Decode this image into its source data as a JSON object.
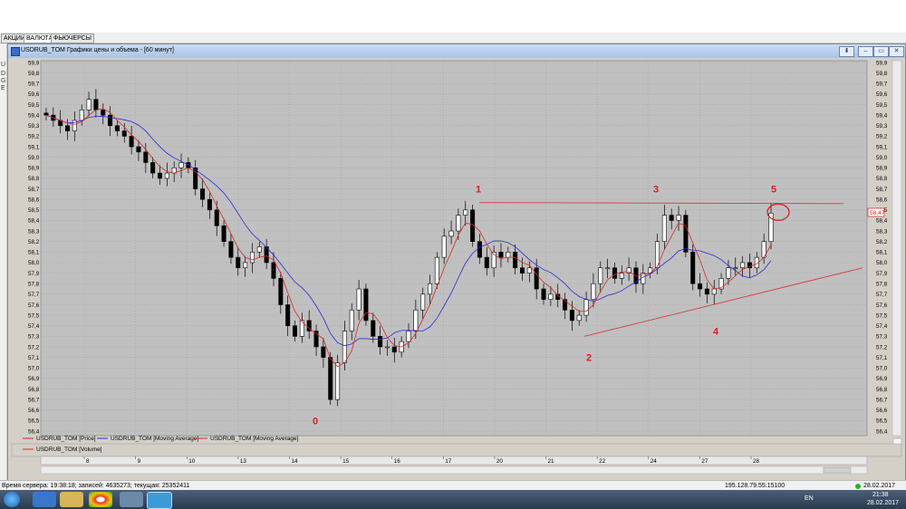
{
  "tabs": [
    "АКЦИИ",
    "ВАЛЮТА",
    "ФЬЮЧЕРСЫ"
  ],
  "left_letters": [
    "U",
    "D",
    "G",
    "E"
  ],
  "window": {
    "title": "USDRUB_TOM Графики цены и объема - [60 минут]"
  },
  "legend": {
    "price": "USDRUB_TOM [Price]",
    "ma1": "USDRUB_TOM [Moving Average]",
    "ma2": "USDRUB_TOM [Moving Average]",
    "volume": "USDRUB_TOM [Volume]"
  },
  "current_price_label": "58,47",
  "status": {
    "server_time": "Время сервера: 19:38:18; записей: 4635273; текущая: 25352411",
    "connection": "195.128.79.55:15100",
    "date": "28.02.2017"
  },
  "taskbar": {
    "lang": "EN",
    "time": "21:38",
    "date": "28.02.2017"
  },
  "colors": {
    "price": "#000000",
    "ma_fast": "#d42a2a",
    "ma_slow": "#2a2ad4",
    "trend": "#d43a3a",
    "annotation": "#d42020"
  },
  "chart_data": {
    "type": "candlestick",
    "ylim": [
      56.4,
      59.9
    ],
    "yticks": [
      59.9,
      59.8,
      59.7,
      59.6,
      59.5,
      59.4,
      59.3,
      59.2,
      59.1,
      59.0,
      58.9,
      58.8,
      58.7,
      58.6,
      58.5,
      58.4,
      58.3,
      58.2,
      58.1,
      58.0,
      57.9,
      57.8,
      57.7,
      57.6,
      57.5,
      57.4,
      57.3,
      57.2,
      57.1,
      57.0,
      56.9,
      56.8,
      56.7,
      56.6,
      56.5,
      56.4
    ],
    "x_labels": [
      "8",
      "9",
      "10",
      "13",
      "14",
      "15",
      "16",
      "17",
      "20",
      "21",
      "22",
      "24",
      "27",
      "28"
    ],
    "close_series": [
      59.4,
      59.35,
      59.3,
      59.25,
      59.35,
      59.45,
      59.55,
      59.45,
      59.4,
      59.3,
      59.25,
      59.2,
      59.1,
      59.05,
      58.95,
      58.85,
      58.8,
      58.85,
      58.9,
      58.95,
      58.9,
      58.7,
      58.6,
      58.5,
      58.35,
      58.2,
      58.05,
      57.95,
      58.0,
      58.1,
      58.15,
      58.0,
      57.85,
      57.6,
      57.4,
      57.3,
      57.45,
      57.35,
      57.2,
      57.1,
      56.7,
      57.05,
      57.35,
      57.55,
      57.75,
      57.45,
      57.3,
      57.2,
      57.2,
      57.15,
      57.25,
      57.35,
      57.55,
      57.7,
      57.8,
      58.05,
      58.25,
      58.3,
      58.45,
      58.5,
      58.2,
      58.05,
      57.95,
      58.1,
      58.05,
      58.1,
      57.95,
      57.9,
      57.95,
      57.75,
      57.65,
      57.7,
      57.65,
      57.55,
      57.45,
      57.5,
      57.65,
      57.8,
      57.95,
      57.95,
      57.85,
      57.9,
      57.95,
      57.8,
      57.9,
      57.95,
      58.2,
      58.45,
      58.4,
      58.45,
      58.1,
      57.8,
      57.75,
      57.7,
      57.75,
      57.85,
      57.95,
      57.95,
      58.0,
      57.95,
      58.05,
      58.2,
      58.47
    ],
    "annotations": [
      {
        "text": "0",
        "price": 56.5
      },
      {
        "text": "1",
        "price": 58.7
      },
      {
        "text": "2",
        "price": 57.1
      },
      {
        "text": "3",
        "price": 58.7
      },
      {
        "text": "4",
        "price": 57.35
      },
      {
        "text": "5",
        "price": 58.7
      }
    ],
    "resistance_level": 58.57,
    "support_line": {
      "from": 57.3,
      "to": 57.95
    }
  }
}
